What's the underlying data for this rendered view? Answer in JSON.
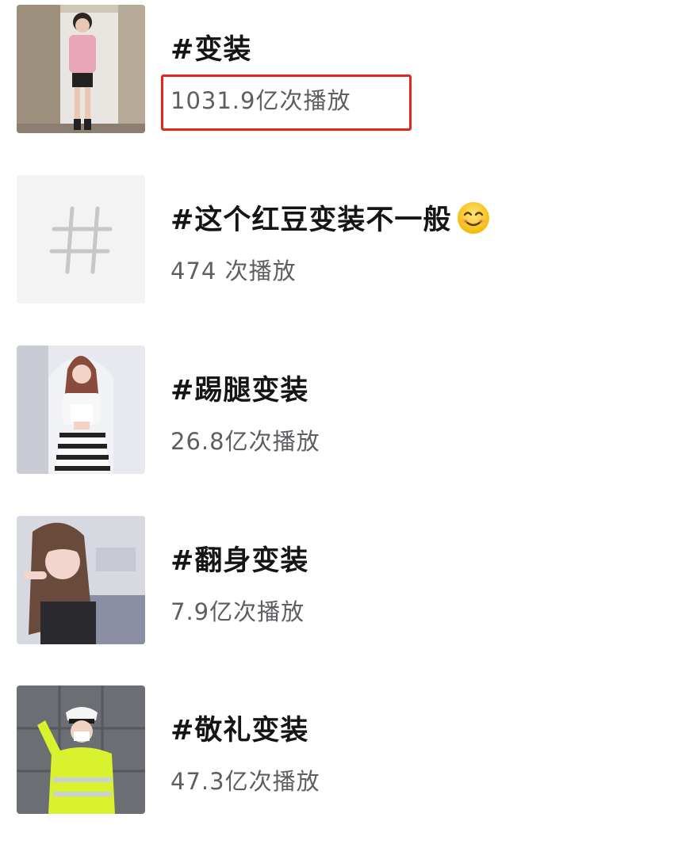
{
  "topics": [
    {
      "title": "#变装",
      "count": "1031.9亿次播放",
      "thumb_icon": "person-photo-icon"
    },
    {
      "title": "#这个红豆变装不一般",
      "count": "474 次播放",
      "thumb_icon": "hashtag-icon",
      "emoji": "smiling-face-icon"
    },
    {
      "title": "#踢腿变装",
      "count": "26.8亿次播放",
      "thumb_icon": "person-photo-icon"
    },
    {
      "title": "#翻身变装",
      "count": "7.9亿次播放",
      "thumb_icon": "person-photo-icon"
    },
    {
      "title": "#敬礼变装",
      "count": "47.3亿次播放",
      "thumb_icon": "person-photo-icon"
    }
  ],
  "highlight": {
    "color": "#e3261f",
    "target": "topics.0.count"
  }
}
